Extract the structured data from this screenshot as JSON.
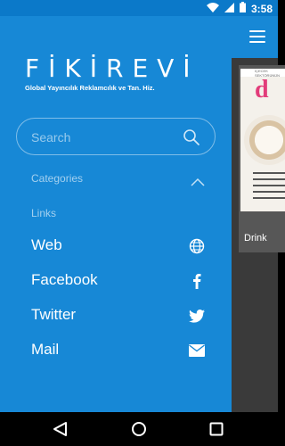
{
  "status_bar": {
    "time": "3:58"
  },
  "app": {
    "card_label": "Drink",
    "card_image_text": "İÇECEK SEKTÖRÜNÜN"
  },
  "drawer": {
    "logo_title": "FİKİREVİ",
    "logo_subtitle": "Global Yayıncılık Reklamcılık ve Tan. Hiz.",
    "search_placeholder": "Search",
    "categories_label": "Categories",
    "links_label": "Links",
    "items": [
      {
        "label": "Web",
        "icon": "globe-icon"
      },
      {
        "label": "Facebook",
        "icon": "facebook-icon"
      },
      {
        "label": "Twitter",
        "icon": "twitter-icon"
      },
      {
        "label": "Mail",
        "icon": "mail-icon"
      }
    ]
  },
  "colors": {
    "drawer_bg": "#1788d6",
    "status_bar_bg": "#0b79c9",
    "app_bg": "#3a3a3a"
  }
}
